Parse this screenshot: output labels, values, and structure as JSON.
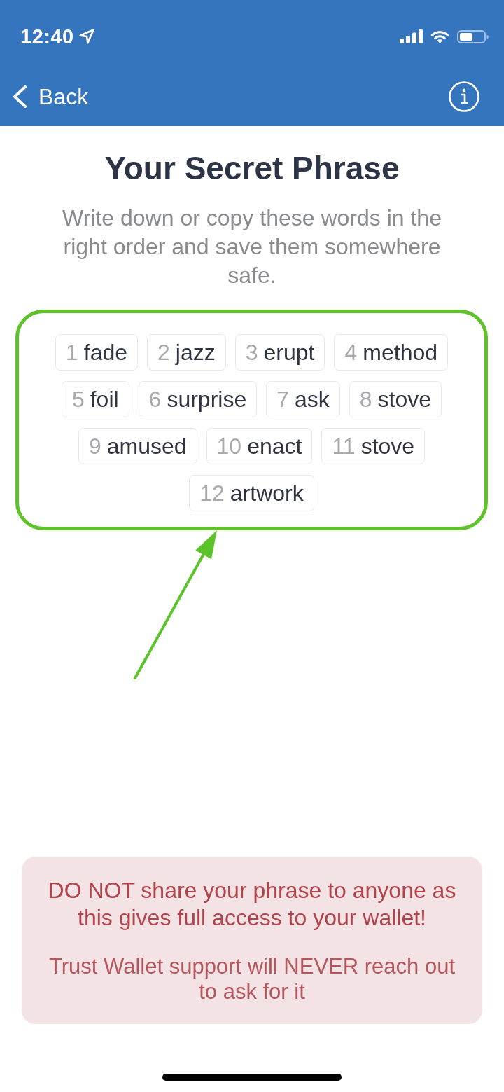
{
  "status_bar": {
    "time": "12:40"
  },
  "nav": {
    "back": "Back"
  },
  "title": "Your Secret Phrase",
  "subtitle": "Write down or copy these words in the right order and save them somewhere safe.",
  "words": [
    {
      "number": "1",
      "word": "fade"
    },
    {
      "number": "2",
      "word": "jazz"
    },
    {
      "number": "3",
      "word": "erupt"
    },
    {
      "number": "4",
      "word": "method"
    },
    {
      "number": "5",
      "word": "foil"
    },
    {
      "number": "6",
      "word": "surprise"
    },
    {
      "number": "7",
      "word": "ask"
    },
    {
      "number": "8",
      "word": "stove"
    },
    {
      "number": "9",
      "word": "amused"
    },
    {
      "number": "10",
      "word": "enact"
    },
    {
      "number": "11",
      "word": "stove"
    },
    {
      "number": "12",
      "word": "artwork"
    }
  ],
  "warning": {
    "lines": [
      "DO NOT share your phrase to anyone as this gives full access to your wallet!",
      "Trust Wallet support will NEVER reach out to ask for it"
    ]
  }
}
